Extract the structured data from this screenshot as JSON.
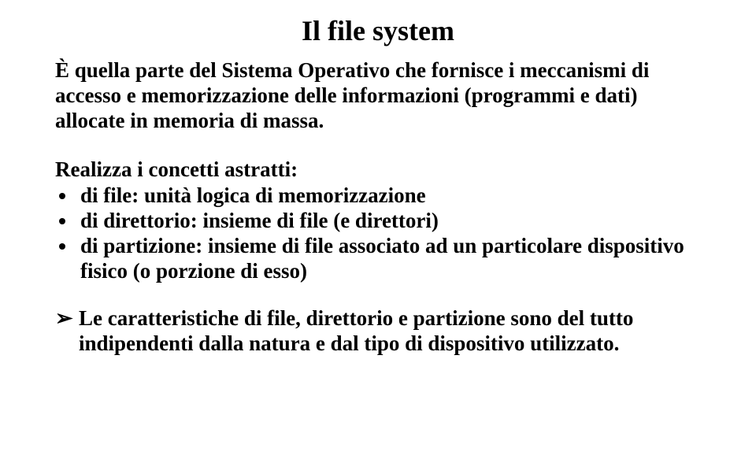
{
  "title": "Il file system",
  "intro": "È quella parte del Sistema Operativo che fornisce i meccanismi di accesso e memorizzazione delle informazioni (programmi e dati) allocate in memoria di massa.",
  "concepts_lead": "Realizza i concetti astratti:",
  "bullets": [
    "di file: unità logica  di memorizzazione",
    "di direttorio: insieme di file (e direttori)",
    "di partizione: insieme di file associato ad un particolare dispositivo fisico (o porzione di esso)"
  ],
  "final_marker": "➢",
  "final": "Le caratteristiche di file, direttorio e partizione sono del tutto indipendenti dalla natura e dal tipo di dispositivo utilizzato."
}
